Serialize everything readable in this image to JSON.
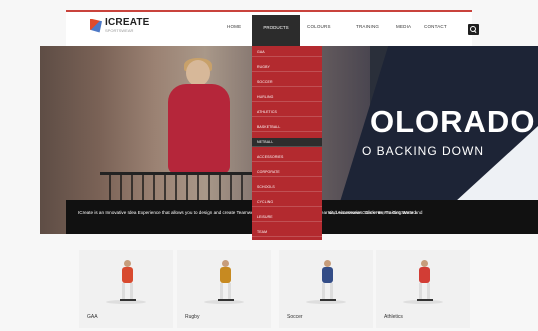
{
  "header": {
    "logo_name": "ICREATE",
    "logo_tagline": "SPORTSWEAR"
  },
  "nav": {
    "items": [
      "HOME",
      "PRODUCTS",
      "COLOURS",
      "TRAINING",
      "MEDIA",
      "CONTACT"
    ]
  },
  "hero": {
    "headline": "OLORADO",
    "subline": "O BACKING DOWN",
    "caption_left": "ICreate is an Innovative Idea Experience that allows you to design and create Teamwear, Leisure Garments, Training Wear and Accessories. Click Here to Get Started",
    "caption_right": "Kit, Leisurewear Garments, Training Wear and"
  },
  "dropdown": {
    "items": [
      "GAA",
      "RUGBY",
      "SOCCER",
      "HURLING",
      "ATHLETICS",
      "BASKETBALL",
      "NETBALL",
      "ACCESSORIES",
      "CORPORATE",
      "SCHOOLS",
      "CYCLING",
      "LEISURE",
      "TEAM"
    ],
    "active_index": 6
  },
  "cards": [
    {
      "label": "GAA",
      "color": "#d84a2f"
    },
    {
      "label": "Rugby",
      "color": "#c78a21"
    },
    {
      "label": "Soccer",
      "color": "#344d87"
    },
    {
      "label": "Athletics",
      "color": "#d23d35"
    }
  ]
}
